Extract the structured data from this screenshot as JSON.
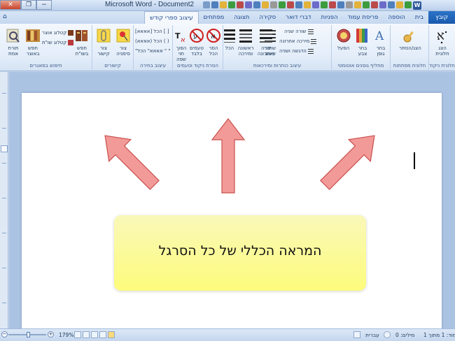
{
  "window": {
    "title": "Microsoft Word - Document2",
    "minimize_glyph": "−",
    "restore_glyph": "❐",
    "close_glyph": "✕",
    "word_badge": "W"
  },
  "tabs": {
    "items": [
      {
        "label": "קובץ",
        "kind": "file"
      },
      {
        "label": "בית"
      },
      {
        "label": "הוספה"
      },
      {
        "label": "פריסת עמוד"
      },
      {
        "label": "הפניות"
      },
      {
        "label": "דברי דואר"
      },
      {
        "label": "סקירה"
      },
      {
        "label": "תצוגה"
      },
      {
        "label": "מפתחים"
      },
      {
        "label": "עיצוב ספרי קודש",
        "active": true
      }
    ],
    "help_glyph": "⌂"
  },
  "ribbon": {
    "g1": {
      "label": "חלונית ניקוד",
      "btn": "הצג\nחלונית"
    },
    "g2": {
      "label": "חלונית מפתחות",
      "btn": "הצג/הסתר"
    },
    "g3": {
      "label": "מחליף גופנים אוטומטי",
      "b1": "בחר\nגופן",
      "b2": "בחר\nצבע",
      "b3": "הפעל"
    },
    "g4": {
      "label": "עיצוב כותרות ומירכאות",
      "s1": "שורה שניה",
      "s2": "מירכה אחרונה",
      "s3": "הדגשה ושניה",
      "b1": "שחזר\nעיצוב",
      "b2": "שניה\nואחרונה",
      "b3": "ראשונה\nומירכה",
      "b4": "הכל"
    },
    "g5": {
      "label": "הסרת ניקוד וטעמים",
      "b1": "הסר\nהכל",
      "b2": "טעמים\nבלבד",
      "b3": "הפוך\nתוי שפה"
    },
    "g6": {
      "label": "עיצוב בחירה",
      "s1": "[אאאא] הכל [ ]",
      "s2": "(אאאא) הכל ( )",
      "s3": "\"אאאא\" הכל \" \""
    },
    "g7": {
      "label": "קישורים",
      "b1": "צור\nסימניה",
      "b2": "צור\nקישור"
    },
    "g8": {
      "label": "חיפוש במאגרים",
      "s1": "קטלוג אוצר",
      "s2": "קטלוג שו\"ת",
      "b1": "חפש\nבשו\"ת",
      "b2": "חפש\nבאוצר",
      "b3": "תורת\nאמת"
    }
  },
  "document": {
    "callout_text": "המראה הכללי של כל הסרגל"
  },
  "statusbar": {
    "page": "עמוד: 1 מתוך 1",
    "words": "מילים: 0",
    "language": "עברית",
    "zoom": "179%",
    "zoom_minus": "−",
    "zoom_plus": "+"
  },
  "colors": {
    "file_tab": "#1a5aad",
    "arrow_fill": "#f29a98",
    "arrow_stroke": "#c8504d",
    "callout_top": "#f9f8b9",
    "callout_bottom": "#fdfc7c"
  }
}
